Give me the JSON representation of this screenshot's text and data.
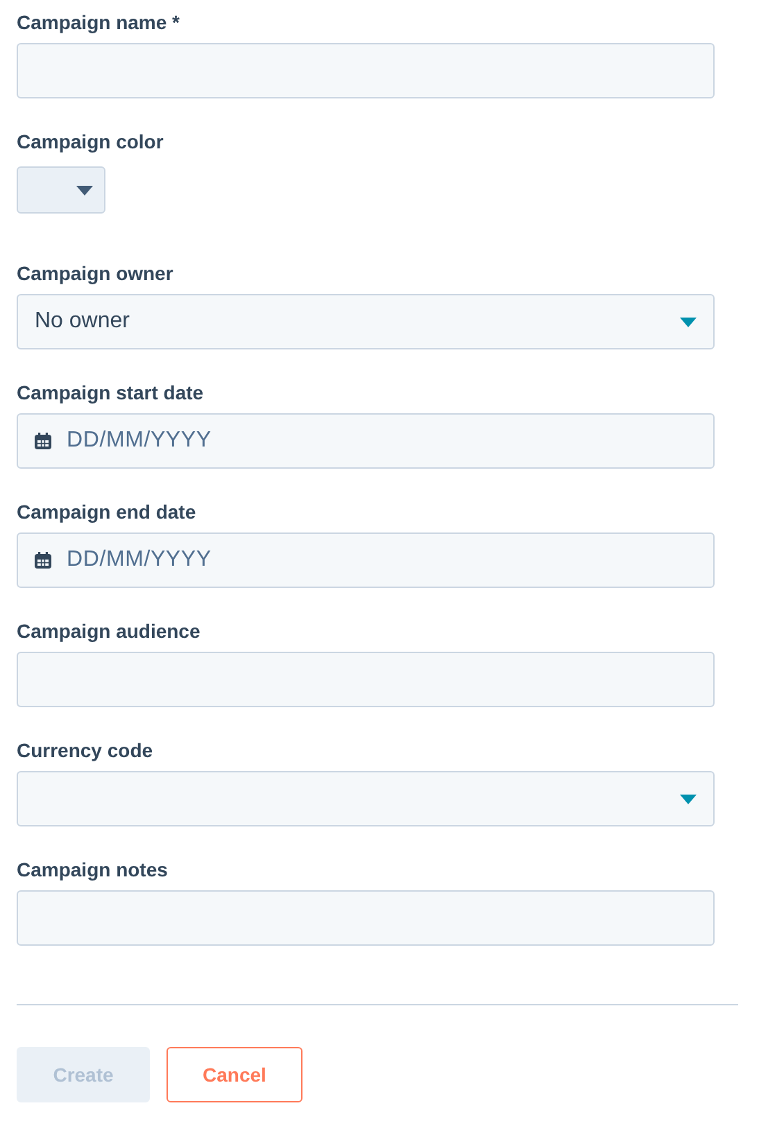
{
  "fields": [
    {
      "kind": "text",
      "label": "Campaign name *"
    },
    {
      "kind": "color",
      "label": "Campaign color"
    },
    {
      "kind": "select",
      "label": "Campaign owner",
      "value": "No owner"
    },
    {
      "kind": "date",
      "label": "Campaign start date",
      "placeholder": "DD/MM/YYYY"
    },
    {
      "kind": "date",
      "label": "Campaign end date",
      "placeholder": "DD/MM/YYYY"
    },
    {
      "kind": "text",
      "label": "Campaign audience"
    },
    {
      "kind": "select",
      "label": "Currency code"
    },
    {
      "kind": "text",
      "label": "Campaign notes"
    }
  ],
  "buttons": [
    {
      "kind": "primary",
      "label": "Create",
      "disabled": true
    },
    {
      "kind": "secondary",
      "label": "Cancel",
      "disabled": false
    }
  ]
}
